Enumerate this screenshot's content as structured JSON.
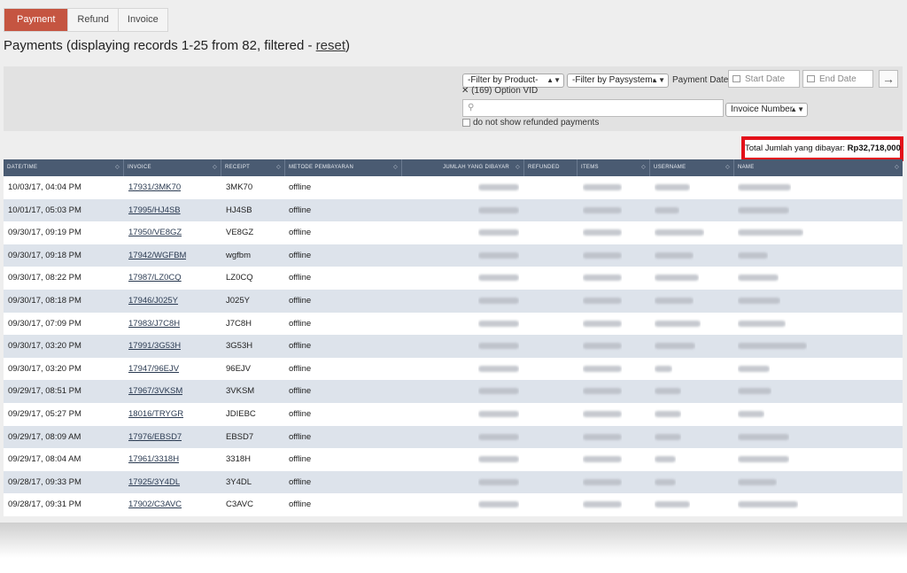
{
  "tabs": [
    {
      "label": "Payment",
      "active": true
    },
    {
      "label": "Refund",
      "active": false
    },
    {
      "label": "Invoice",
      "active": false
    }
  ],
  "heading": {
    "text": "Payments (displaying records 1-25 from 82, filtered - ",
    "reset_link": "reset",
    "suffix": ")"
  },
  "filters": {
    "product": "-Filter by Product-",
    "paysystem": "-Filter by Paysystem-",
    "payment_date_label": "Payment Date:",
    "start_date_placeholder": "Start Date",
    "end_date_placeholder": "End Date",
    "go_icon": "arrow-right-icon",
    "selected_product": "(169) Option VID",
    "remove_icon": "close-icon",
    "search_placeholder": "",
    "search_field": "Invoice Number",
    "refund_checkbox_label": "do not show refunded payments",
    "refund_checkbox_checked": false
  },
  "total": {
    "label": "Total Jumlah yang dibayar:",
    "value": "Rp32,718,000",
    "highlight_color": "#e3101a"
  },
  "table": {
    "columns": [
      "DATE/TIME",
      "INVOICE",
      "RECEIPT",
      "METODE PEMBAYARAN",
      "JUMLAH YANG DIBAYAR",
      "REFUNDED",
      "ITEMS",
      "USERNAME",
      "NAME"
    ],
    "rows": [
      {
        "date": "10/03/17, 04:04 PM",
        "invoice": "17931/3MK70",
        "receipt": "3MK70",
        "method": "offline"
      },
      {
        "date": "10/01/17, 05:03 PM",
        "invoice": "17995/HJ4SB",
        "receipt": "HJ4SB",
        "method": "offline"
      },
      {
        "date": "09/30/17, 09:19 PM",
        "invoice": "17950/VE8GZ",
        "receipt": "VE8GZ",
        "method": "offline"
      },
      {
        "date": "09/30/17, 09:18 PM",
        "invoice": "17942/WGFBM",
        "receipt": "wgfbm",
        "method": "offline"
      },
      {
        "date": "09/30/17, 08:22 PM",
        "invoice": "17987/LZ0CQ",
        "receipt": "LZ0CQ",
        "method": "offline"
      },
      {
        "date": "09/30/17, 08:18 PM",
        "invoice": "17946/J025Y",
        "receipt": "J025Y",
        "method": "offline"
      },
      {
        "date": "09/30/17, 07:09 PM",
        "invoice": "17983/J7C8H",
        "receipt": "J7C8H",
        "method": "offline"
      },
      {
        "date": "09/30/17, 03:20 PM",
        "invoice": "17991/3G53H",
        "receipt": "3G53H",
        "method": "offline"
      },
      {
        "date": "09/30/17, 03:20 PM",
        "invoice": "17947/96EJV",
        "receipt": "96EJV",
        "method": "offline"
      },
      {
        "date": "09/29/17, 08:51 PM",
        "invoice": "17967/3VKSM",
        "receipt": "3VKSM",
        "method": "offline"
      },
      {
        "date": "09/29/17, 05:27 PM",
        "invoice": "18016/TRYGR",
        "receipt": "JDIEBC",
        "method": "offline"
      },
      {
        "date": "09/29/17, 08:09 AM",
        "invoice": "17976/EBSD7",
        "receipt": "EBSD7",
        "method": "offline"
      },
      {
        "date": "09/29/17, 08:04 AM",
        "invoice": "17961/3318H",
        "receipt": "3318H",
        "method": "offline"
      },
      {
        "date": "09/28/17, 09:33 PM",
        "invoice": "17925/3Y4DL",
        "receipt": "3Y4DL",
        "method": "offline"
      },
      {
        "date": "09/28/17, 09:31 PM",
        "invoice": "17902/C3AVC",
        "receipt": "C3AVC",
        "method": "offline"
      }
    ]
  }
}
